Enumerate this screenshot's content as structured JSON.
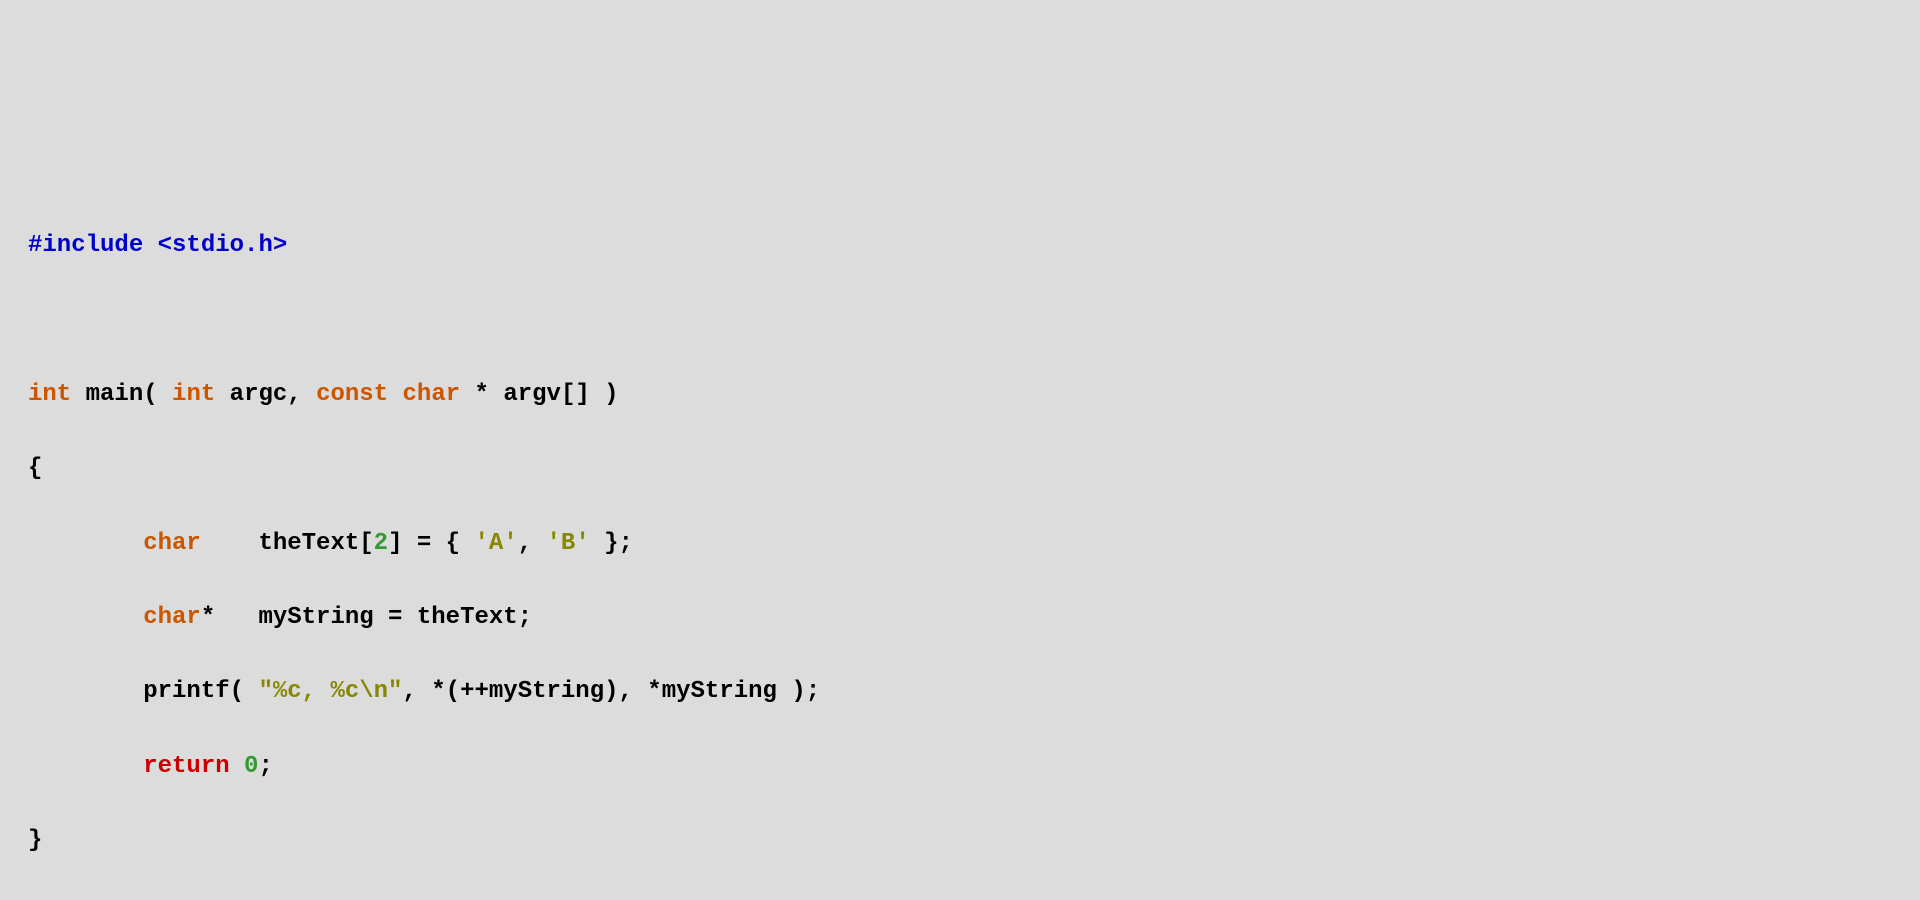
{
  "code": {
    "line1": {
      "include_hash": "#include",
      "include_file": " <stdio.h>"
    },
    "line2": "",
    "line3": {
      "ret_type": "int",
      "func_name": " main( ",
      "param1_type": "int",
      "param1_name": " argc, ",
      "param2_kw1": "const",
      "param2_sp": " ",
      "param2_kw2": "char",
      "param2_name": " * argv[] )"
    },
    "line4": "{",
    "line5": {
      "indent": "        ",
      "kw": "char",
      "text1": "    theText[",
      "arraysize": "2",
      "text2": "] = { ",
      "charA": "'A'",
      "comma": ", ",
      "charB": "'B'",
      "end": " };"
    },
    "line6": {
      "indent": "        ",
      "kw": "char",
      "text": "*   myString = theText;"
    },
    "line7": {
      "indent": "        ",
      "fn": "printf( ",
      "fmt": "\"%c, %c\\n\"",
      "args": ", *(++myString), *myString );"
    },
    "line8": {
      "indent": "        ",
      "kw": "return",
      "sp": " ",
      "val": "0",
      "semi": ";"
    },
    "line9": "}"
  }
}
